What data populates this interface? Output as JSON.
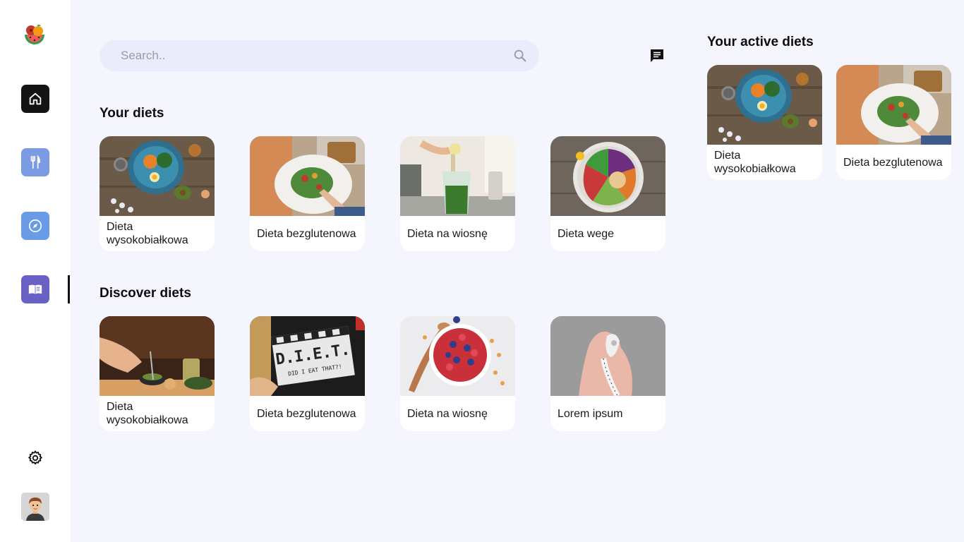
{
  "search": {
    "placeholder": "Search.."
  },
  "sections": {
    "your_diets": {
      "title": "Your diets",
      "cards": [
        {
          "label": "Dieta wysokobiałkowa"
        },
        {
          "label": "Dieta bezglutenowa"
        },
        {
          "label": "Dieta na wiosnę"
        },
        {
          "label": "Dieta wege"
        }
      ]
    },
    "discover_diets": {
      "title": "Discover diets",
      "cards": [
        {
          "label": "Dieta wysokobiałkowa"
        },
        {
          "label": "Dieta bezglutenowa"
        },
        {
          "label": "Dieta na wiosnę"
        },
        {
          "label": "Lorem ipsum"
        }
      ]
    },
    "active_diets": {
      "title": "Your active diets",
      "cards": [
        {
          "label": "Dieta wysokobiałkowa"
        },
        {
          "label": "Dieta bezglutenowa"
        }
      ]
    }
  },
  "sidebar": {
    "items": [
      {
        "icon": "home-icon"
      },
      {
        "icon": "fork-knife-icon"
      },
      {
        "icon": "compass-icon"
      },
      {
        "icon": "book-icon",
        "active": true
      }
    ],
    "settings_icon": "gear-icon",
    "avatar_icon": "user-avatar"
  },
  "colors": {
    "background": "#f5f5fd",
    "sidebar": "#ffffff",
    "nav_home": "#141414",
    "nav_food": "#7b9be4",
    "nav_explore": "#6a9be6",
    "nav_book": "#6a61c4"
  }
}
